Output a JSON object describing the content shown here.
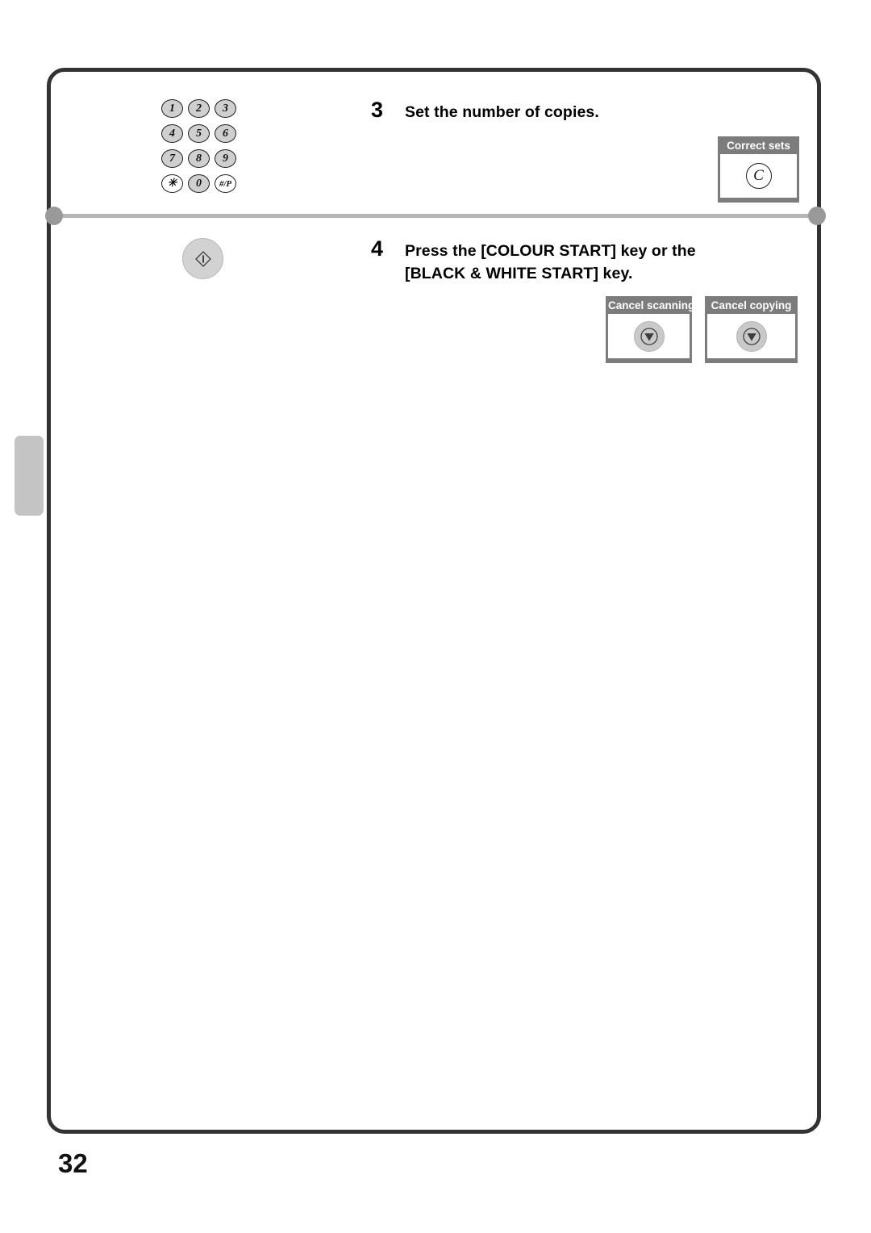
{
  "page": {
    "number": "32"
  },
  "steps": [
    {
      "number": "3",
      "text": "Set the number of copies."
    },
    {
      "number": "4",
      "text": "Press the [COLOUR START] key or the [BLACK & WHITE START] key."
    }
  ],
  "keypad": {
    "keys": [
      {
        "label": "1",
        "filled": true
      },
      {
        "label": "2",
        "filled": true
      },
      {
        "label": "3",
        "filled": true
      },
      {
        "label": "4",
        "filled": true
      },
      {
        "label": "5",
        "filled": true
      },
      {
        "label": "6",
        "filled": true
      },
      {
        "label": "7",
        "filled": true
      },
      {
        "label": "8",
        "filled": true
      },
      {
        "label": "9",
        "filled": true
      },
      {
        "label": "✳",
        "filled": false
      },
      {
        "label": "0",
        "filled": true
      },
      {
        "label": "#/P",
        "filled": false
      }
    ]
  },
  "callouts": {
    "correct_sets": {
      "label": "Correct sets",
      "key_label": "C",
      "icon": "clear-key-icon"
    },
    "cancel_scanning": {
      "label": "Cancel scanning",
      "icon": "stop-key-icon"
    },
    "cancel_copying": {
      "label": "Cancel copying",
      "icon": "stop-key-icon"
    }
  },
  "start_key": {
    "icon": "start-key-icon"
  },
  "colors": {
    "callout_frame": "#7c7c7c",
    "key_fill": "#cfcfcf",
    "side_tab": "#c4c4c4",
    "divider": "#b6b6b6",
    "border": "#333335"
  }
}
